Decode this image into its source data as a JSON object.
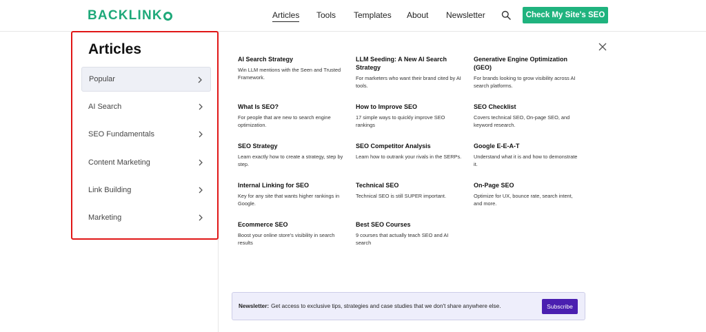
{
  "header": {
    "logo_text": "BACKLINK",
    "nav": [
      "Articles",
      "Tools",
      "Templates",
      "About",
      "Newsletter"
    ],
    "cta_label": "Check My Site's SEO"
  },
  "sidebar": {
    "title": "Articles",
    "items": [
      {
        "label": "Popular",
        "active": true
      },
      {
        "label": "AI Search",
        "active": false
      },
      {
        "label": "SEO Fundamentals",
        "active": false
      },
      {
        "label": "Content Marketing",
        "active": false
      },
      {
        "label": "Link Building",
        "active": false
      },
      {
        "label": "Marketing",
        "active": false
      }
    ]
  },
  "articles": [
    {
      "title": "AI Search Strategy",
      "desc": "Win LLM mentions with the Seen and Trusted Framework."
    },
    {
      "title": "LLM Seeding: A New AI Search Strategy",
      "desc": "For marketers who want their brand cited by AI tools."
    },
    {
      "title": "Generative Engine Optimization (GEO)",
      "desc": "For brands looking to grow visibility across AI search platforms."
    },
    {
      "title": "What Is SEO?",
      "desc": "For people that are new to search engine optimization."
    },
    {
      "title": "How to Improve SEO",
      "desc": "17 simple ways to quickly improve SEO rankings"
    },
    {
      "title": "SEO Checklist",
      "desc": "Covers technical SEO, On-page SEO, and keyword research."
    },
    {
      "title": "SEO Strategy",
      "desc": "Learn exactly how to create a strategy, step by step."
    },
    {
      "title": "SEO Competitor Analysis",
      "desc": "Learn how to outrank your rivals in the SERPs."
    },
    {
      "title": "Google E-E-A-T",
      "desc": "Understand what it is and how to demonstrate it."
    },
    {
      "title": "Internal Linking for SEO",
      "desc": "Key for any site that wants higher rankings in Google."
    },
    {
      "title": "Technical SEO",
      "desc": "Technical SEO is still SUPER important."
    },
    {
      "title": "On-Page SEO",
      "desc": "Optimize for UX, bounce rate, search intent, and more."
    },
    {
      "title": "Ecommerce SEO",
      "desc": "Boost your online store’s visibility in search results"
    },
    {
      "title": "Best SEO Courses",
      "desc": "9 courses that actually teach SEO and AI search"
    }
  ],
  "newsletter": {
    "label": "Newsletter:",
    "text": "Get access to exclusive tips, strategies and case studies that we don't share anywhere else.",
    "button": "Subscribe"
  },
  "colors": {
    "brand_green": "#1fa97a",
    "cta_green": "#1fb37e",
    "highlight_red": "#e01515",
    "subscribe_purple": "#4a1fb0"
  },
  "icons": [
    "search-icon",
    "close-icon",
    "chevron-right-icon"
  ]
}
